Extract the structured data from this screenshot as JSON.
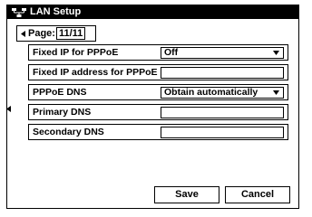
{
  "window": {
    "title": "LAN Setup",
    "title_icon": "network-icon"
  },
  "page_nav": {
    "label": "Page:",
    "value": "11/11"
  },
  "settings": {
    "fixed_ip_pppoe": {
      "label": "Fixed IP for PPPoE",
      "value": "Off"
    },
    "fixed_ip_address_pppoe": {
      "label": "Fixed IP address for PPPoE",
      "value": ""
    },
    "pppoe_dns": {
      "label": "PPPoE DNS",
      "value": "Obtain automatically"
    },
    "primary_dns": {
      "label": "Primary DNS",
      "value": ""
    },
    "secondary_dns": {
      "label": "Secondary DNS",
      "value": ""
    }
  },
  "buttons": {
    "save": "Save",
    "cancel": "Cancel"
  }
}
